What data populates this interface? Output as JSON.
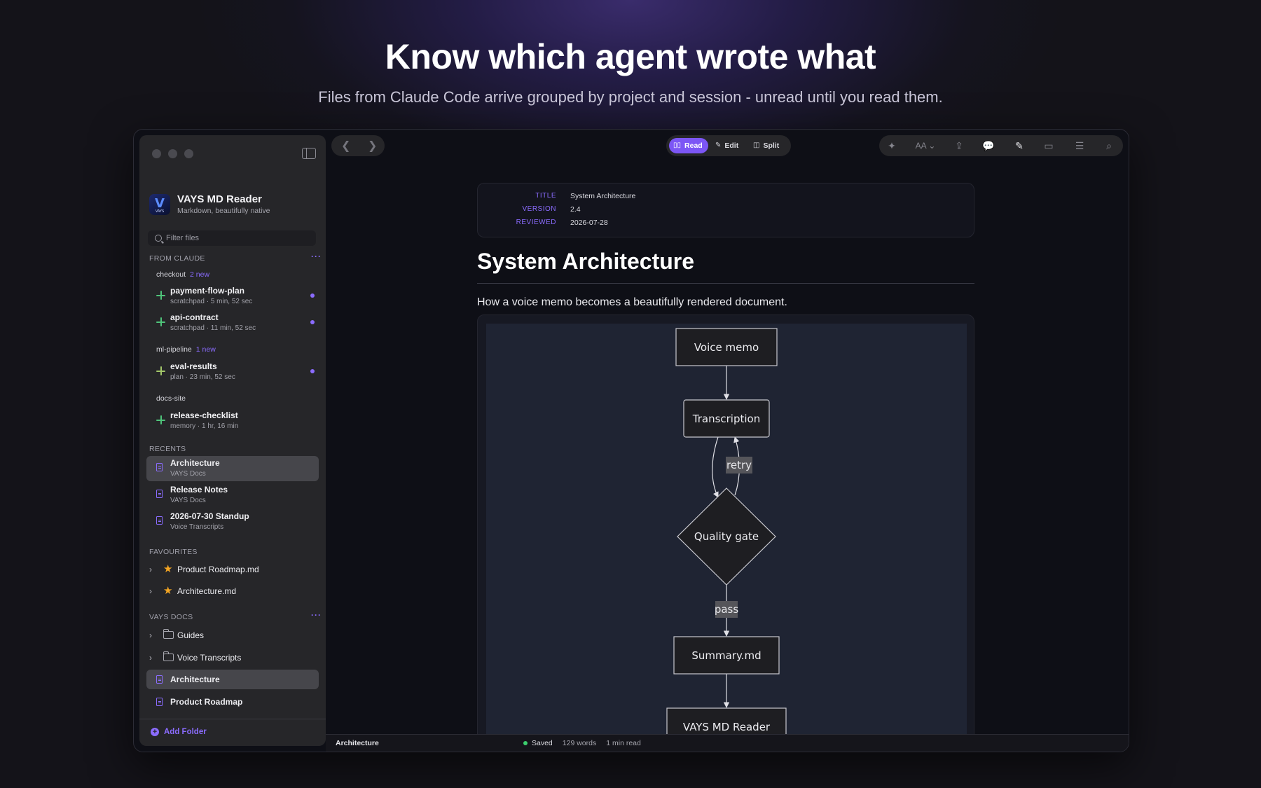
{
  "hero": {
    "headline": "Know which agent wrote what",
    "subline": "Files from Claude Code arrive grouped by project and session - unread until you read them."
  },
  "sidebar": {
    "app_name": "VAYS MD Reader",
    "app_tagline": "Markdown, beautifully native",
    "filter_placeholder": "Filter files",
    "from_claude": {
      "heading": "FROM CLAUDE",
      "groups": [
        {
          "name": "checkout",
          "badge": "2 new",
          "files": [
            {
              "title": "payment-flow-plan",
              "meta": "scratchpad · 5 min, 52 sec",
              "unread": true
            },
            {
              "title": "api-contract",
              "meta": "scratchpad · 11 min, 52 sec",
              "unread": true
            }
          ]
        },
        {
          "name": "ml-pipeline",
          "badge": "1 new",
          "files": [
            {
              "title": "eval-results",
              "meta": "plan · 23 min, 52 sec",
              "unread": true
            }
          ]
        },
        {
          "name": "docs-site",
          "badge": "",
          "files": [
            {
              "title": "release-checklist",
              "meta": "memory · 1 hr, 16 min",
              "unread": false
            }
          ]
        }
      ]
    },
    "recents": {
      "heading": "RECENTS",
      "items": [
        {
          "title": "Architecture",
          "sub": "VAYS Docs",
          "selected": true
        },
        {
          "title": "Release Notes",
          "sub": "VAYS Docs",
          "selected": false
        },
        {
          "title": "2026-07-30 Standup",
          "sub": "Voice Transcripts",
          "selected": false
        }
      ]
    },
    "favourites": {
      "heading": "FAVOURITES",
      "items": [
        "Product Roadmap.md",
        "Architecture.md"
      ]
    },
    "vays_docs": {
      "heading": "VAYS DOCS",
      "folders": [
        "Guides",
        "Voice Transcripts"
      ],
      "files": [
        "Architecture",
        "Product Roadmap"
      ],
      "selected_file": "Architecture"
    },
    "add_folder": "Add Folder"
  },
  "toolbar": {
    "modes": [
      "Read",
      "Edit",
      "Split"
    ],
    "active_mode": "Read",
    "tools": [
      "sparkle-icon",
      "text-size-icon",
      "share-icon",
      "comment-icon",
      "highlighter-icon",
      "window-icon",
      "reader-icon",
      "search-icon"
    ],
    "text_size_label": "AA"
  },
  "document": {
    "frontmatter": [
      {
        "key": "TITLE",
        "value": "System Architecture"
      },
      {
        "key": "VERSION",
        "value": "2.4"
      },
      {
        "key": "REVIEWED",
        "value": "2026-07-28"
      }
    ],
    "title": "System Architecture",
    "lead": "How a voice memo becomes a beautifully rendered document.",
    "diagram": {
      "nodes": [
        "Voice memo",
        "Transcription",
        "Quality gate",
        "Summary.md",
        "VAYS MD Reader"
      ],
      "edge_labels": [
        "retry",
        "pass"
      ]
    }
  },
  "statusbar": {
    "file": "Architecture",
    "saved": "Saved",
    "words": "129 words",
    "read_time": "1 min read"
  },
  "colors": {
    "accent": "#8b6cff",
    "active_mode": "#7c56f5",
    "saved_dot": "#3ccf6e",
    "favourite_star": "#f5a623",
    "session_spark": "#4fc47a"
  }
}
